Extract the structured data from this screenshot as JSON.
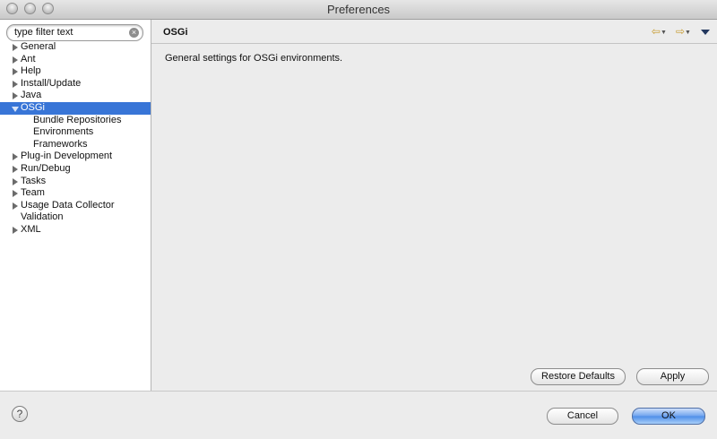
{
  "window": {
    "title": "Preferences"
  },
  "filter": {
    "placeholder": "type filter text"
  },
  "tree": [
    {
      "label": "General",
      "expandable": true
    },
    {
      "label": "Ant",
      "expandable": true
    },
    {
      "label": "Help",
      "expandable": true
    },
    {
      "label": "Install/Update",
      "expandable": true
    },
    {
      "label": "Java",
      "expandable": true
    },
    {
      "label": "OSGi",
      "expanded": true,
      "selected": true
    },
    {
      "label": "Bundle Repositories",
      "child": true
    },
    {
      "label": "Environments",
      "child": true
    },
    {
      "label": "Frameworks",
      "child": true
    },
    {
      "label": "Plug-in Development",
      "expandable": true
    },
    {
      "label": "Run/Debug",
      "expandable": true
    },
    {
      "label": "Tasks",
      "expandable": true
    },
    {
      "label": "Team",
      "expandable": true
    },
    {
      "label": "Usage Data Collector",
      "expandable": true
    },
    {
      "label": "Validation",
      "expandable": false
    },
    {
      "label": "XML",
      "expandable": true
    }
  ],
  "page": {
    "title": "OSGi",
    "description": "General settings for OSGi environments."
  },
  "buttons": {
    "restore_defaults": "Restore Defaults",
    "apply": "Apply",
    "cancel": "Cancel",
    "ok": "OK"
  },
  "icons": {
    "help": "help-icon",
    "back": "back-arrow-icon",
    "forward": "forward-arrow-icon",
    "view_menu": "view-menu-icon",
    "clear": "clear-icon"
  },
  "colors": {
    "selection": "#3875d7",
    "nav_arrow": "#c79a2d"
  }
}
